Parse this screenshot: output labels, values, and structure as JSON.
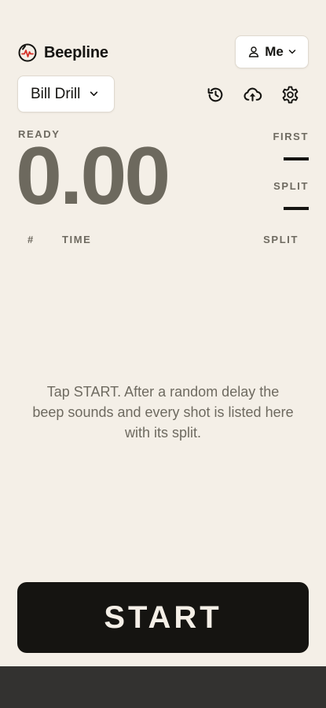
{
  "app": {
    "name": "Beepline"
  },
  "header": {
    "user_label": "Me"
  },
  "drill": {
    "selected": "Bill Drill"
  },
  "timer": {
    "status": "READY",
    "display": "0.00"
  },
  "stats": {
    "first_label": "FIRST",
    "split_label": "SPLIT"
  },
  "shots": {
    "columns": [
      "#",
      "TIME",
      "SPLIT"
    ],
    "rows": [],
    "empty_message": "Tap START. After a random delay the beep sounds and every shot is listed here with its split."
  },
  "controls": {
    "start_label": "START"
  },
  "icons": {
    "logo": "timer-logo-icon",
    "user": "user-icon",
    "history": "history-icon",
    "upload": "cloud-upload-icon",
    "settings": "gear-icon"
  },
  "colors": {
    "background": "#f4efe7",
    "ink": "#151411",
    "muted": "#6e6a60",
    "accent": "#d6322a",
    "start_button": "#151411"
  }
}
